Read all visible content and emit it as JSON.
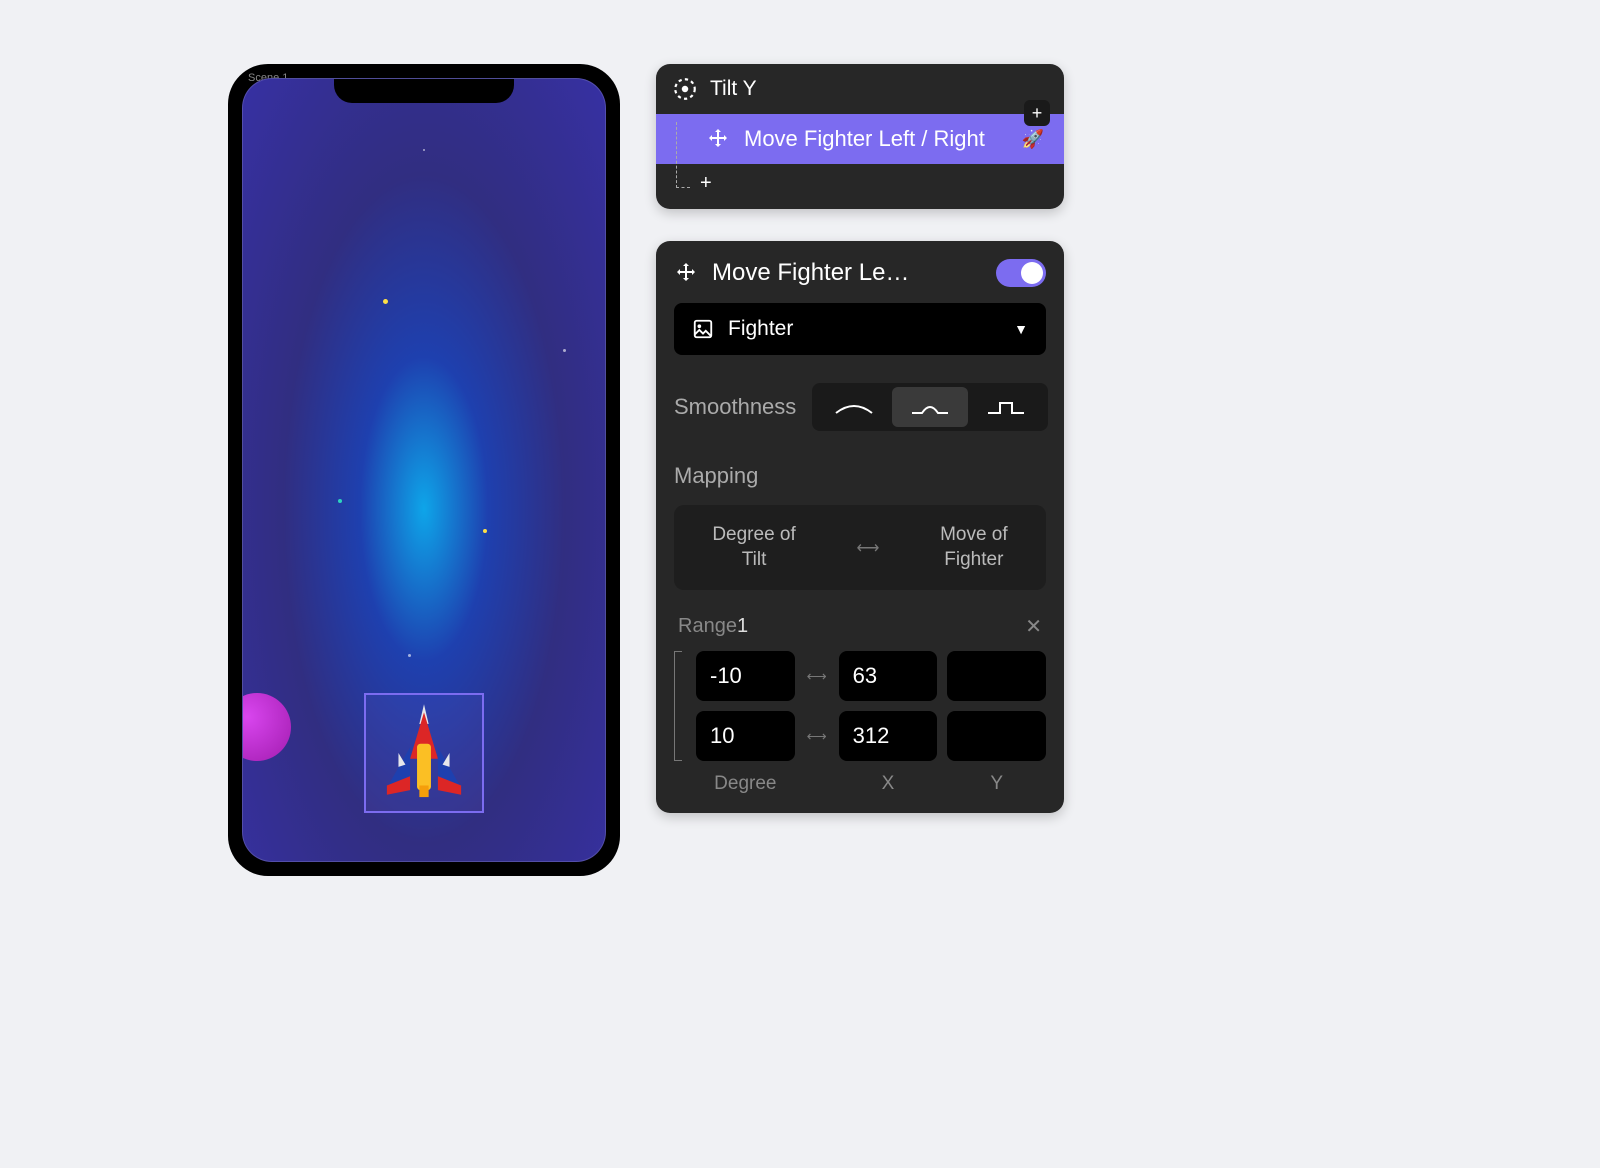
{
  "phone": {
    "scene_label": "Scene 1"
  },
  "trigger_panel": {
    "trigger_name": "Tilt Y",
    "action_label": "Move Fighter Left / Right"
  },
  "props_panel": {
    "title": "Move Fighter Le…",
    "target_label": "Fighter",
    "smoothness_label": "Smoothness",
    "smoothness_selected": 1,
    "mapping_heading": "Mapping",
    "mapping_left_line1": "Degree of",
    "mapping_left_line2": "Tilt",
    "mapping_right_line1": "Move of",
    "mapping_right_line2": "Fighter",
    "range_label": "Range",
    "range_num": "1",
    "range_rows": [
      {
        "degree": "-10",
        "x": "63",
        "y": ""
      },
      {
        "degree": "10",
        "x": "312",
        "y": ""
      }
    ],
    "col_degree": "Degree",
    "col_x": "X",
    "col_y": "Y"
  }
}
